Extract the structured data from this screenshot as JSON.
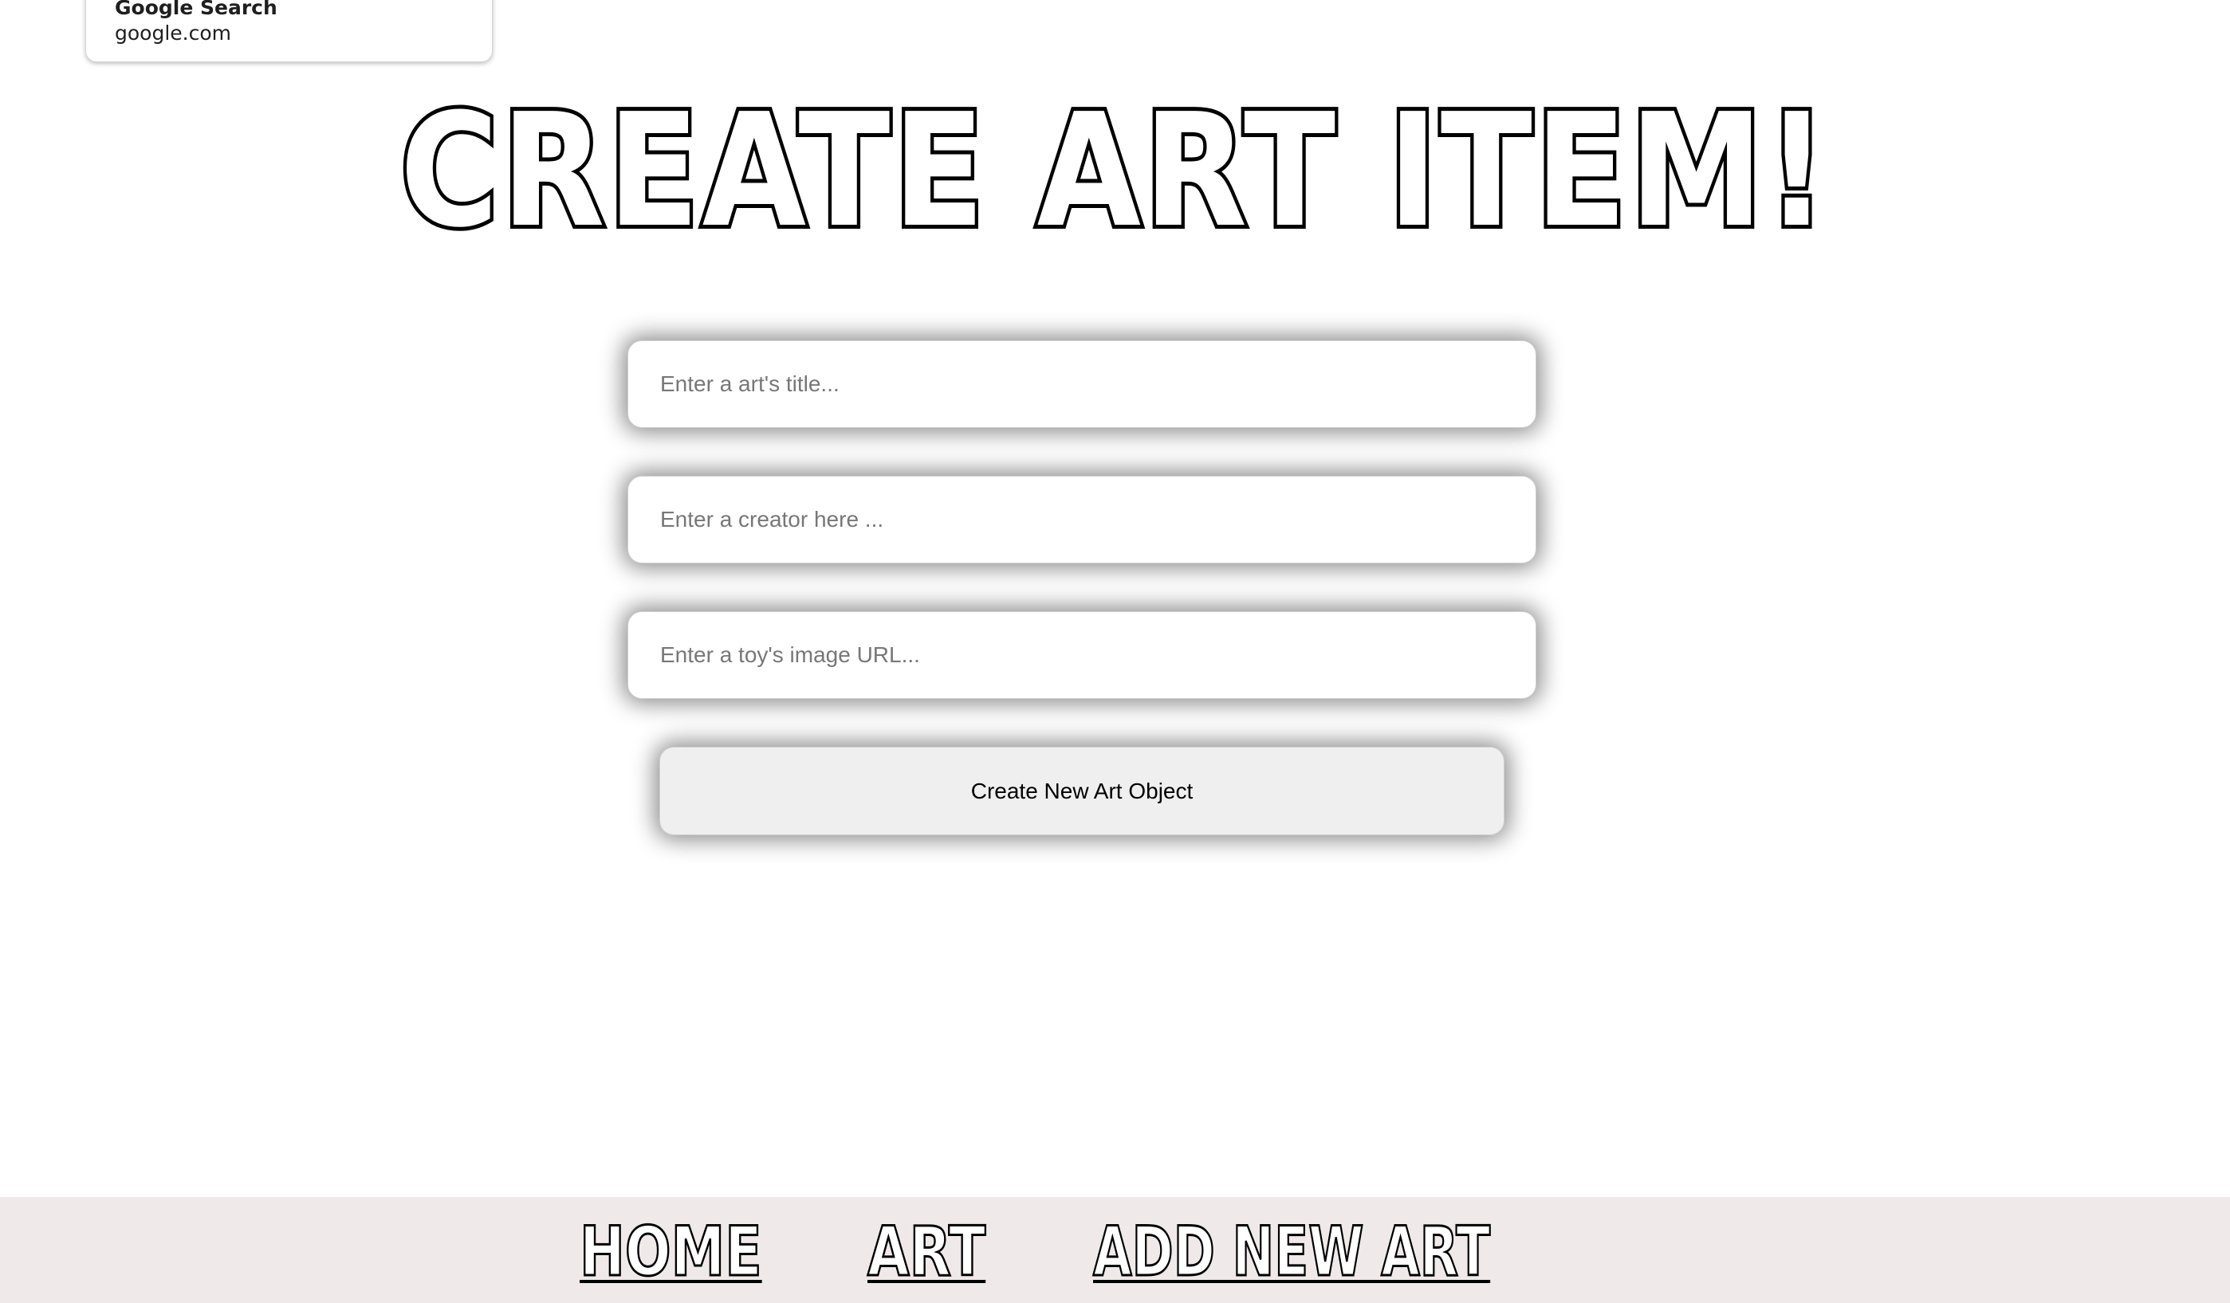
{
  "suggestion_popup": {
    "title": "Google Search",
    "url": "google.com"
  },
  "page": {
    "title": "CREATE ART ITEM!"
  },
  "form": {
    "title_placeholder": "Enter a art's title...",
    "creator_placeholder": "Enter a creator here ...",
    "image_placeholder": "Enter a toy's image URL...",
    "submit_label": "Create New Art Object"
  },
  "footer_nav": {
    "items": [
      {
        "label": "HOME"
      },
      {
        "label": "ART"
      },
      {
        "label": "ADD NEW ART"
      }
    ]
  },
  "colors": {
    "footer_background": "#efe9e9",
    "button_background": "#efefef",
    "text": "#000000"
  }
}
